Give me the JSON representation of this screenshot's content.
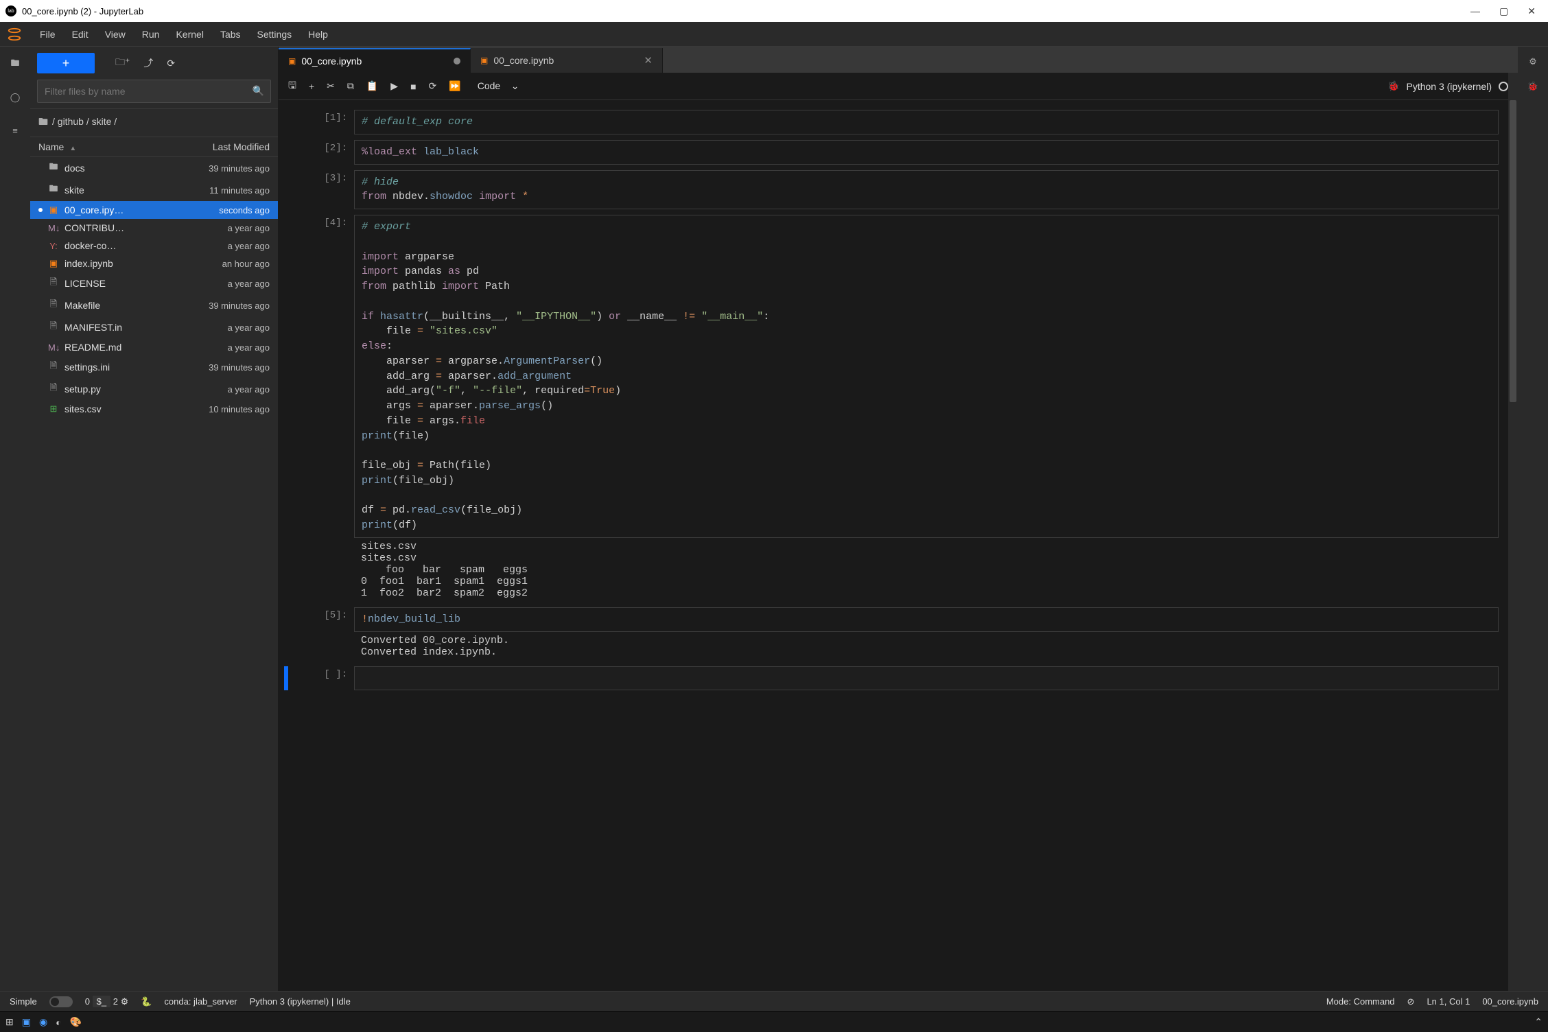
{
  "window": {
    "title": "00_core.ipynb (2) - JupyterLab"
  },
  "menubar": [
    "File",
    "Edit",
    "View",
    "Run",
    "Kernel",
    "Tabs",
    "Settings",
    "Help"
  ],
  "sidebar": {
    "filter_placeholder": "Filter files by name",
    "breadcrumb": "/ github / skite /",
    "header_name": "Name",
    "header_modified": "Last Modified",
    "files": [
      {
        "icon": "folder",
        "name": "docs",
        "modified": "39 minutes ago"
      },
      {
        "icon": "folder",
        "name": "skite",
        "modified": "11 minutes ago"
      },
      {
        "icon": "notebook",
        "name": "00_core.ipy…",
        "modified": "seconds ago",
        "selected": true,
        "dirty": true
      },
      {
        "icon": "md",
        "name": "CONTRIBU…",
        "modified": "a year ago"
      },
      {
        "icon": "yaml",
        "name": "docker-co…",
        "modified": "a year ago"
      },
      {
        "icon": "notebook",
        "name": "index.ipynb",
        "modified": "an hour ago"
      },
      {
        "icon": "file",
        "name": "LICENSE",
        "modified": "a year ago"
      },
      {
        "icon": "file",
        "name": "Makefile",
        "modified": "39 minutes ago"
      },
      {
        "icon": "file",
        "name": "MANIFEST.in",
        "modified": "a year ago"
      },
      {
        "icon": "md",
        "name": "README.md",
        "modified": "a year ago"
      },
      {
        "icon": "file",
        "name": "settings.ini",
        "modified": "39 minutes ago"
      },
      {
        "icon": "file",
        "name": "setup.py",
        "modified": "a year ago"
      },
      {
        "icon": "csv",
        "name": "sites.csv",
        "modified": "10 minutes ago"
      }
    ]
  },
  "tabs": [
    {
      "label": "00_core.ipynb",
      "active": true,
      "dirty": true
    },
    {
      "label": "00_core.ipynb",
      "active": false
    }
  ],
  "nb_toolbar": {
    "celltype": "Code",
    "kernel_name": "Python 3 (ipykernel)"
  },
  "cells": [
    {
      "prompt": "[1]:",
      "code_html": "<span class='c-comment'># default_exp core</span>"
    },
    {
      "prompt": "[2]:",
      "code_html": "<span class='c-magic'>%load_ext</span> <span class='c-magic2'>lab_black</span>"
    },
    {
      "prompt": "[3]:",
      "code_html": "<span class='c-comment'># hide</span>\n<span class='c-keyword'>from</span> nbdev.<span class='c-func'>showdoc</span> <span class='c-keyword'>import</span> <span class='c-operator'>*</span>"
    },
    {
      "prompt": "[4]:",
      "code_html": "<span class='c-comment'># export</span>\n\n<span class='c-keyword'>import</span> argparse\n<span class='c-keyword'>import</span> pandas <span class='c-keyword'>as</span> pd\n<span class='c-keyword'>from</span> pathlib <span class='c-keyword'>import</span> Path\n\n<span class='c-keyword'>if</span> <span class='c-builtin'>hasattr</span>(__builtins__, <span class='c-string'>\"__IPYTHON__\"</span>) <span class='c-keyword'>or</span> __name__ <span class='c-operator'>!=</span> <span class='c-string'>\"__main__\"</span>:\n    file <span class='c-operator'>=</span> <span class='c-string'>\"sites.csv\"</span>\n<span class='c-keyword'>else</span>:\n    aparser <span class='c-operator'>=</span> argparse.<span class='c-func'>ArgumentParser</span>()\n    add_arg <span class='c-operator'>=</span> aparser.<span class='c-func'>add_argument</span>\n    add_arg(<span class='c-string'>\"-f\"</span>, <span class='c-string'>\"--file\"</span>, required<span class='c-operator'>=</span><span class='c-bool'>True</span>)\n    args <span class='c-operator'>=</span> aparser.<span class='c-func'>parse_args</span>()\n    file <span class='c-operator'>=</span> args.<span class='c-var'>file</span>\n<span class='c-builtin'>print</span>(file)\n\nfile_obj <span class='c-operator'>=</span> Path(file)\n<span class='c-builtin'>print</span>(file_obj)\n\ndf <span class='c-operator'>=</span> pd.<span class='c-func'>read_csv</span>(file_obj)\n<span class='c-builtin'>print</span>(df)",
      "output": "sites.csv\nsites.csv\n    foo   bar   spam   eggs\n0  foo1  bar1  spam1  eggs1\n1  foo2  bar2  spam2  eggs2"
    },
    {
      "prompt": "[5]:",
      "code_html": "<span class='c-operator'>!</span><span class='c-magic2'>nbdev_build_lib</span>",
      "output": "Converted 00_core.ipynb.\nConverted index.ipynb."
    },
    {
      "prompt": "[ ]:",
      "code_html": " ",
      "active": true
    }
  ],
  "statusbar": {
    "simple": "Simple",
    "counter1": "0",
    "counter2": "2",
    "conda": "conda: jlab_server",
    "kernel": "Python 3 (ipykernel) | Idle",
    "mode": "Mode: Command",
    "cursor": "Ln 1, Col 1",
    "file": "00_core.ipynb"
  }
}
